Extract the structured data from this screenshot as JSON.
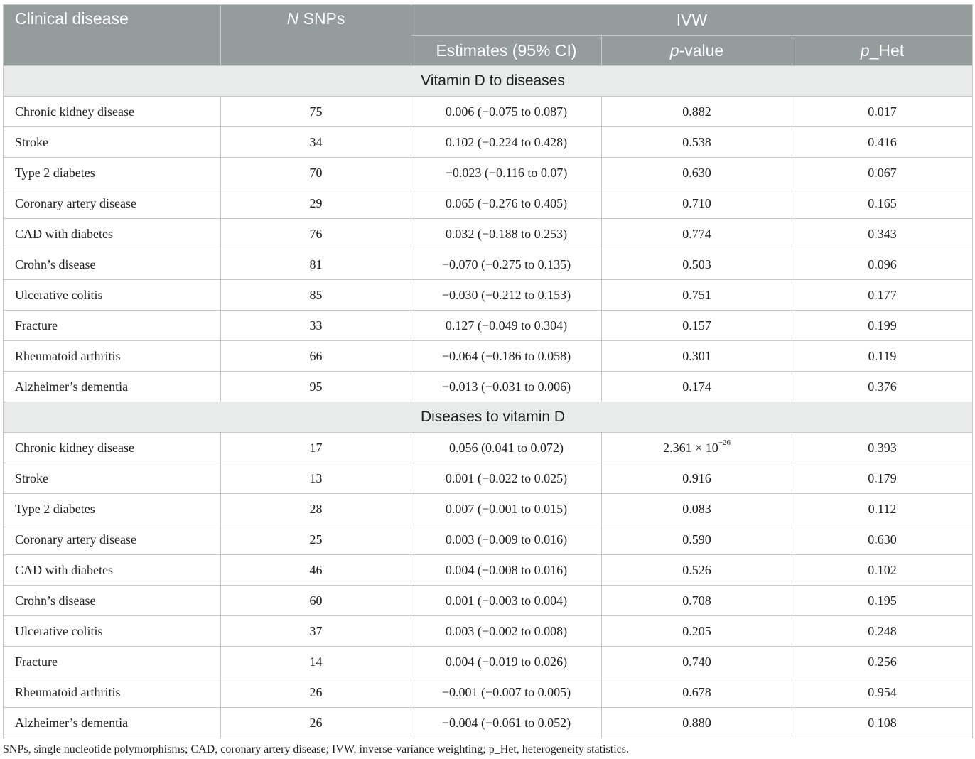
{
  "header": {
    "clinical_disease": "Clinical disease",
    "n_italic": "N",
    "snps": " SNPs",
    "ivw": "IVW",
    "estimates": "Estimates (95% CI)",
    "pvalue_italic": "p",
    "pvalue_rest": "-value",
    "phet_italic": "p",
    "phet_rest": "_Het"
  },
  "sections": [
    {
      "title": "Vitamin D to diseases",
      "rows": [
        {
          "disease": "Chronic kidney disease",
          "n": "75",
          "estimate": "0.006 (−0.075 to 0.087)",
          "p": "0.882",
          "phet": "0.017"
        },
        {
          "disease": "Stroke",
          "n": "34",
          "estimate": "0.102 (−0.224 to 0.428)",
          "p": "0.538",
          "phet": "0.416"
        },
        {
          "disease": "Type 2 diabetes",
          "n": "70",
          "estimate": "−0.023 (−0.116 to 0.07)",
          "p": "0.630",
          "phet": "0.067"
        },
        {
          "disease": "Coronary artery disease",
          "n": "29",
          "estimate": "0.065 (−0.276 to 0.405)",
          "p": "0.710",
          "phet": "0.165"
        },
        {
          "disease": "CAD with diabetes",
          "n": "76",
          "estimate": "0.032 (−0.188 to 0.253)",
          "p": "0.774",
          "phet": "0.343"
        },
        {
          "disease": "Crohn’s disease",
          "n": "81",
          "estimate": "−0.070 (−0.275 to 0.135)",
          "p": "0.503",
          "phet": "0.096"
        },
        {
          "disease": "Ulcerative colitis",
          "n": "85",
          "estimate": "−0.030 (−0.212 to 0.153)",
          "p": "0.751",
          "phet": "0.177"
        },
        {
          "disease": "Fracture",
          "n": "33",
          "estimate": "0.127 (−0.049 to 0.304)",
          "p": "0.157",
          "phet": "0.199"
        },
        {
          "disease": "Rheumatoid arthritis",
          "n": "66",
          "estimate": "−0.064 (−0.186 to 0.058)",
          "p": "0.301",
          "phet": "0.119"
        },
        {
          "disease": "Alzheimer’s dementia",
          "n": "95",
          "estimate": "−0.013 (−0.031 to 0.006)",
          "p": "0.174",
          "phet": "0.376"
        }
      ]
    },
    {
      "title": "Diseases to vitamin D",
      "rows": [
        {
          "disease": "Chronic kidney disease",
          "n": "17",
          "estimate": "0.056 (0.041 to 0.072)",
          "p": "2.361 × 10",
          "p_exp": "−26",
          "phet": "0.393"
        },
        {
          "disease": "Stroke",
          "n": "13",
          "estimate": "0.001 (−0.022 to 0.025)",
          "p": "0.916",
          "phet": "0.179"
        },
        {
          "disease": "Type 2 diabetes",
          "n": "28",
          "estimate": "0.007 (−0.001 to 0.015)",
          "p": "0.083",
          "phet": "0.112"
        },
        {
          "disease": "Coronary artery disease",
          "n": "25",
          "estimate": "0.003 (−0.009 to 0.016)",
          "p": "0.590",
          "phet": "0.630"
        },
        {
          "disease": "CAD with diabetes",
          "n": "46",
          "estimate": "0.004 (−0.008 to 0.016)",
          "p": "0.526",
          "phet": "0.102"
        },
        {
          "disease": "Crohn’s disease",
          "n": "60",
          "estimate": "0.001 (−0.003 to 0.004)",
          "p": "0.708",
          "phet": "0.195"
        },
        {
          "disease": "Ulcerative colitis",
          "n": "37",
          "estimate": "0.003 (−0.002 to 0.008)",
          "p": "0.205",
          "phet": "0.248"
        },
        {
          "disease": "Fracture",
          "n": "14",
          "estimate": "0.004 (−0.019 to 0.026)",
          "p": "0.740",
          "phet": "0.256"
        },
        {
          "disease": "Rheumatoid arthritis",
          "n": "26",
          "estimate": "−0.001 (−0.007 to 0.005)",
          "p": "0.678",
          "phet": "0.954"
        },
        {
          "disease": "Alzheimer’s dementia",
          "n": "26",
          "estimate": "−0.004 (−0.061 to 0.052)",
          "p": "0.880",
          "phet": "0.108"
        }
      ]
    }
  ],
  "footnote": "SNPs, single nucleotide polymorphisms; CAD, coronary artery disease; IVW, inverse-variance weighting; p_Het, heterogeneity statistics."
}
